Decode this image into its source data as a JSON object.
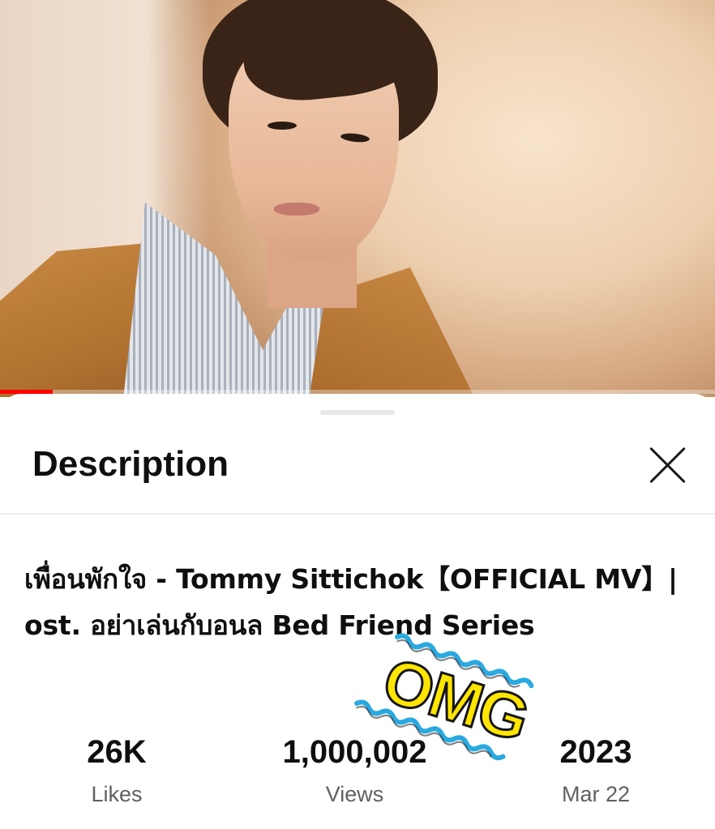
{
  "video": {
    "progress_percent": 7.4
  },
  "sheet": {
    "title": "Description"
  },
  "description": {
    "title": "เพื่อนพักใจ - Tommy Sittichok【OFFICIAL MV】| ost. อย่าเล่นกับอนล Bed Friend Series"
  },
  "stats": {
    "likes": {
      "value": "26K",
      "label": "Likes"
    },
    "views": {
      "value": "1,000,002",
      "label": "Views"
    },
    "date": {
      "value": "2023",
      "label": "Mar 22"
    }
  },
  "sticker": {
    "text": "OMG",
    "text_color": "#ffe500",
    "wave_color": "#2aa9e0"
  },
  "colors": {
    "progress": "#ff0000",
    "primary_text": "#0f0f0f",
    "secondary_text": "#606060"
  }
}
